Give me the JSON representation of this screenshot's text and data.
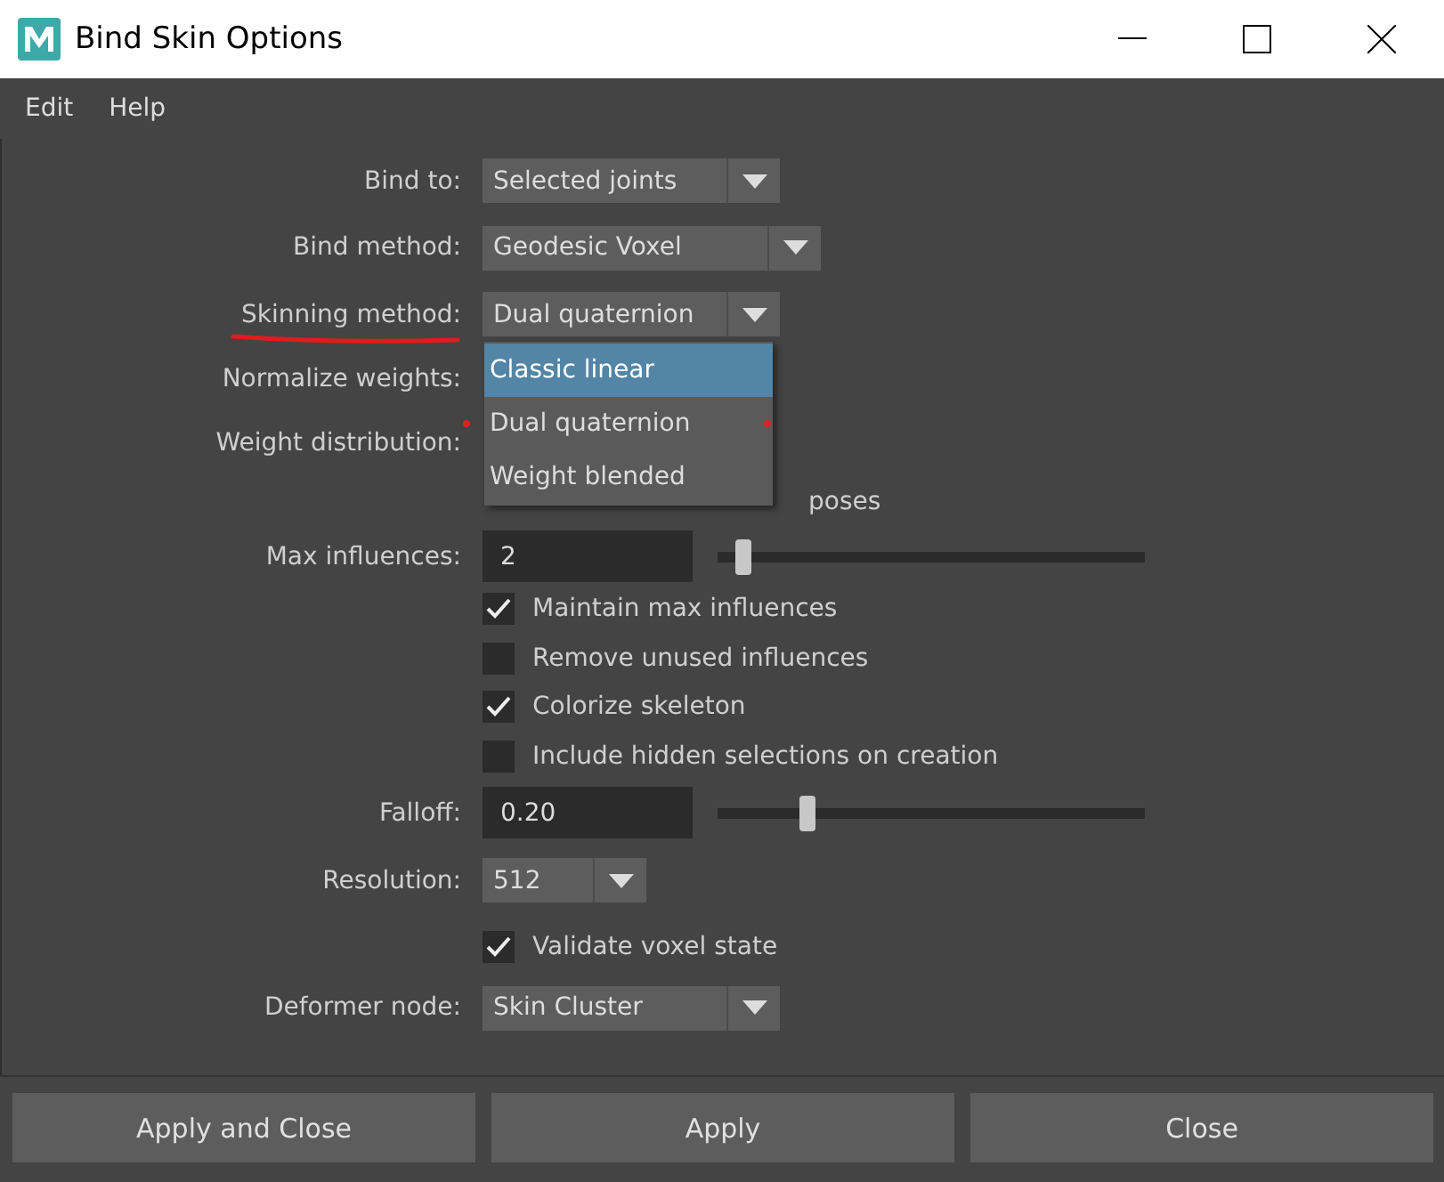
{
  "window": {
    "title": "Bind Skin Options"
  },
  "menu": [
    "Edit",
    "Help"
  ],
  "rows": [
    {
      "kind": "dropdown",
      "label": "Bind to:",
      "value": "Selected joints"
    },
    {
      "kind": "dropdown",
      "label": "Bind method:",
      "value": "Geodesic Voxel"
    },
    {
      "kind": "dropdown",
      "label": "Skinning method:",
      "value": "Dual quaternion",
      "underlined": true
    },
    {
      "kind": "hidden",
      "label": "Normalize weights:"
    },
    {
      "kind": "hidden",
      "label": "Weight distribution:"
    },
    {
      "kind": "text",
      "label": "poses"
    },
    {
      "kind": "slider",
      "label": "Max influences:",
      "value": "2",
      "level": 0.06
    },
    {
      "kind": "checkbox",
      "label": "Maintain max influences",
      "checked": true
    },
    {
      "kind": "checkbox",
      "label": "Remove unused influences",
      "checked": false
    },
    {
      "kind": "checkbox",
      "label": "Colorize skeleton",
      "checked": true
    },
    {
      "kind": "checkbox",
      "label": "Include hidden selections on creation",
      "checked": false
    },
    {
      "kind": "slider",
      "label": "Falloff:",
      "value": "0.20",
      "level": 0.21
    },
    {
      "kind": "dropdown",
      "label": "Resolution:",
      "value": "512"
    },
    {
      "kind": "checkbox",
      "label": "Validate voxel state",
      "checked": true
    },
    {
      "kind": "dropdown",
      "label": "Deformer node:",
      "value": "Skin Cluster"
    }
  ],
  "popup": {
    "open": true,
    "items": [
      {
        "label": "Classic linear",
        "selected": true,
        "marked": false
      },
      {
        "label": "Dual quaternion",
        "selected": false,
        "marked": true
      },
      {
        "label": "Weight blended",
        "selected": false,
        "marked": false
      }
    ]
  },
  "buttons": [
    "Apply and Close",
    "Apply",
    "Close"
  ]
}
